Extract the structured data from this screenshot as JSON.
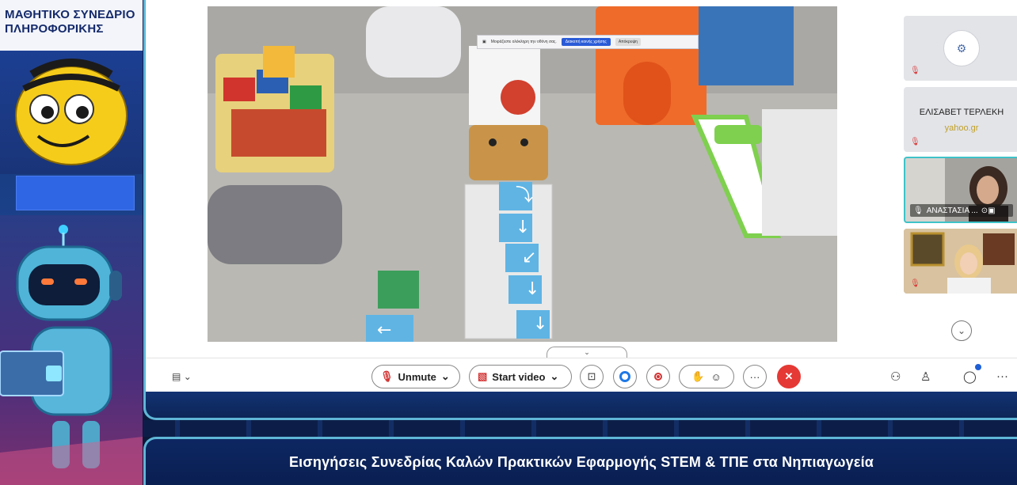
{
  "branding": {
    "conference_title_line1": "ΜΑΘΗΤΙΚΟ ΣΥΝΕΔΡΙΟ",
    "conference_title_line2": "ΠΛΗΡΟΦΟΡΙΚΗΣ"
  },
  "share_banner": {
    "text": "Μοιράζεστε ολόκληρη την οθόνη σας.",
    "stop_label": "Διακοπή κοινής χρήσης",
    "hide_label": "Απόκρυψη"
  },
  "participants": [
    {
      "name": "",
      "muted": true,
      "has_logo": true
    },
    {
      "name": "ΕΛΙΣΑΒΕΤ ΤΕΡΛΕΚΗ",
      "subtitle": "yahoo.gr",
      "muted": true
    },
    {
      "name": "ΑΝΑΣΤΑΣΙΑ ...",
      "muted": false,
      "active": true
    },
    {
      "name": "",
      "muted": true
    }
  ],
  "toolbar": {
    "unmute_label": "Unmute",
    "start_video_label": "Start video",
    "leave_symbol": "✕",
    "more_symbol": "···",
    "chevron": "⌄"
  },
  "caption": {
    "text": "Εισηγήσεις Συνεδρίας Καλών Πρακτικών Εφαρμογής STEM & ΤΠΕ στα Νηπιαγωγεία"
  },
  "colors": {
    "accent_frame": "#5fb6d6",
    "leave_red": "#e53935",
    "brand_blue": "#1e78e6",
    "banner_bg": "#0d2762"
  }
}
